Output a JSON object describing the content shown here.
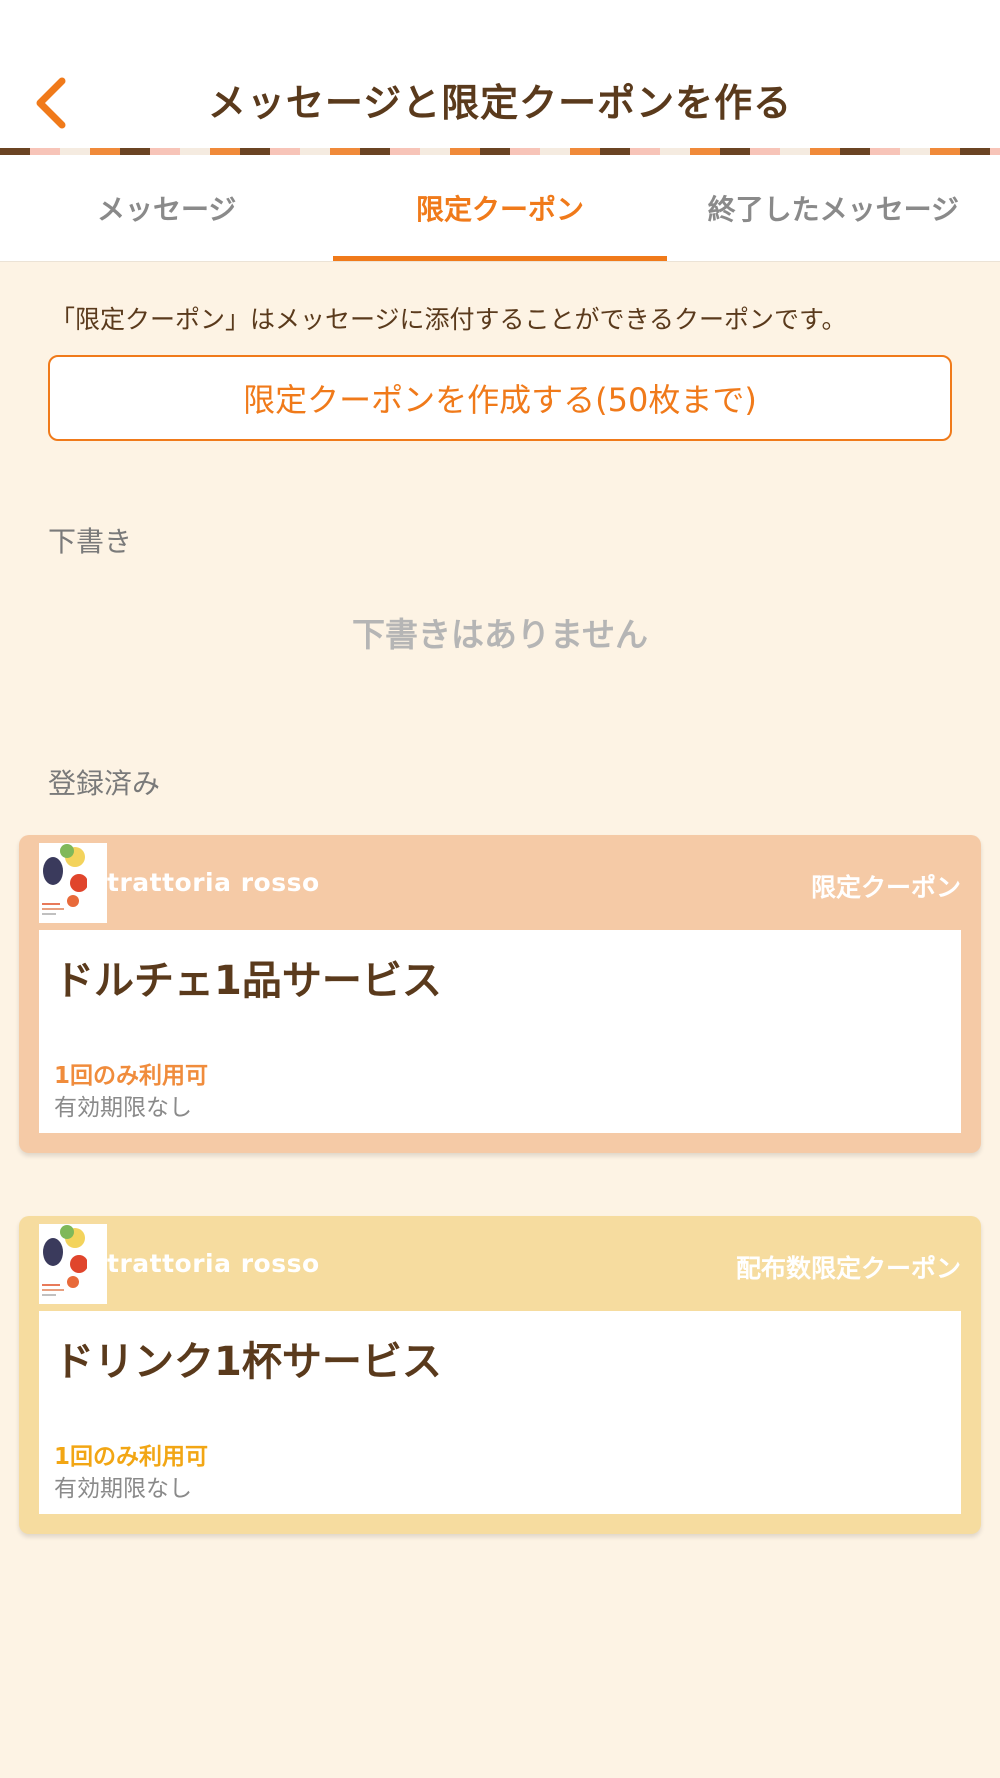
{
  "colors": {
    "accent": "#f07a1a",
    "brown": "#5a3a1c",
    "background": "#fdf3e4",
    "coupon1": "#f5caa6",
    "coupon1_usage": "#f08c3c",
    "coupon2": "#f6dc9f",
    "coupon2_usage": "#f2a614"
  },
  "header": {
    "back_icon": "chevron-left-icon",
    "title": "メッセージと限定クーポンを作る"
  },
  "tabs": [
    {
      "label": "メッセージ",
      "active": false
    },
    {
      "label": "限定クーポン",
      "active": true
    },
    {
      "label": "終了したメッセージ",
      "active": false
    }
  ],
  "main": {
    "description": "「限定クーポン」はメッセージに添付することができるクーポンです。",
    "create_button": "限定クーポンを作成する(50枚まで)",
    "drafts_label": "下書き",
    "drafts_empty": "下書きはありません",
    "registered_label": "登録済み"
  },
  "coupons": [
    {
      "shop": "trattoria rosso",
      "type": "限定クーポン",
      "title": "ドルチェ1品サービス",
      "usage": "1回のみ利用可",
      "expiry": "有効期限なし"
    },
    {
      "shop": "trattoria rosso",
      "type": "配布数限定クーポン",
      "title": "ドリンク1杯サービス",
      "usage": "1回のみ利用可",
      "expiry": "有効期限なし"
    }
  ]
}
